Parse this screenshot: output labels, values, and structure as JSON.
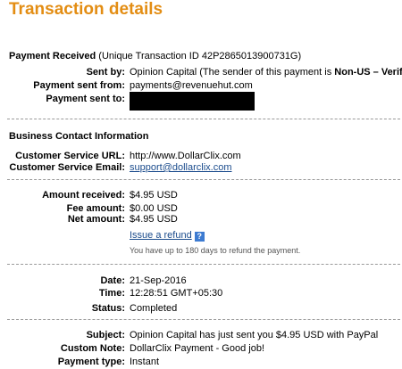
{
  "page": {
    "title": "Transaction details"
  },
  "payment": {
    "received_label": "Payment Received",
    "transaction_text": "(Unique Transaction ID 42P2865013900731G)",
    "sent_by_label": "Sent by:",
    "sent_by_name": "Opinion Capital (The sender of this payment is ",
    "sent_by_status": "Non-US – Verified",
    "sent_by_close": ")",
    "sent_from_label": "Payment sent from:",
    "sent_from_value": "payments@revenuehut.com",
    "sent_to_label": "Payment sent to:"
  },
  "business": {
    "heading": "Business Contact Information",
    "url_label": "Customer Service URL:",
    "url_value": "http://www.DollarClix.com",
    "email_label": "Customer Service Email:",
    "email_value": "support@dollarclix.com"
  },
  "amounts": {
    "received_label": "Amount received:",
    "received_value": "$4.95 USD",
    "fee_label": "Fee amount:",
    "fee_value": "$0.00 USD",
    "net_label": "Net amount:",
    "net_value": "$4.95 USD",
    "refund_link": "Issue a refund",
    "help_icon": "?",
    "refund_note": "You have up to 180 days to refund the payment."
  },
  "details": {
    "date_label": "Date:",
    "date_value": "21-Sep-2016",
    "time_label": "Time:",
    "time_value": "12:28:51 GMT+05:30",
    "status_label": "Status:",
    "status_value": "Completed"
  },
  "message": {
    "subject_label": "Subject:",
    "subject_value": "Opinion Capital has just sent you $4.95 USD with PayPal",
    "note_label": "Custom Note:",
    "note_value": "DollarClix Payment - Good job!",
    "type_label": "Payment type:",
    "type_value": "Instant"
  },
  "colors": {
    "title": "#e38d13",
    "link": "#1a4b8c",
    "help_icon": "#3d7bd1"
  }
}
